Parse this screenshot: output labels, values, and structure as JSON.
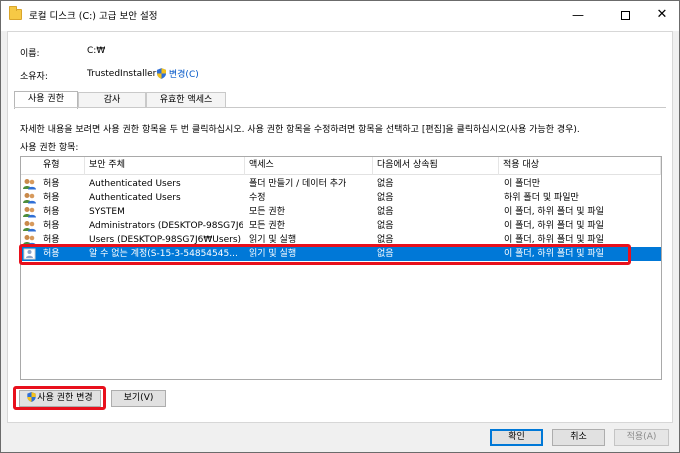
{
  "window": {
    "title": "로컬 디스크 (C:) 고급 보안 설정"
  },
  "info": {
    "name_label": "이름:",
    "name_value": "C:₩",
    "owner_label": "소유자:",
    "owner_value": "TrustedInstaller",
    "change_link": "변경(C)"
  },
  "tabs": [
    {
      "label": "사용 권한",
      "active": true
    },
    {
      "label": "감사",
      "active": false
    },
    {
      "label": "유효한 액세스",
      "active": false
    }
  ],
  "description": "자세한 내용을 보려면 사용 권한 항목을 두 번 클릭하십시오. 사용 권한 항목을 수정하려면 항목을 선택하고 [편집]을 클릭하십시오(사용 가능한 경우).",
  "entries_label": "사용 권한 항목:",
  "columns": [
    "유형",
    "보안 주체",
    "액세스",
    "다음에서 상속됨",
    "적용 대상"
  ],
  "rows": [
    {
      "type": "허용",
      "principal": "Authenticated Users",
      "access": "폴더 만들기 / 데이터 추가",
      "inherited": "없음",
      "applies": "이 폴더만",
      "icon": "users-icon"
    },
    {
      "type": "허용",
      "principal": "Authenticated Users",
      "access": "수정",
      "inherited": "없음",
      "applies": "하위 폴더 및 파일만",
      "icon": "users-icon"
    },
    {
      "type": "허용",
      "principal": "SYSTEM",
      "access": "모든 권한",
      "inherited": "없음",
      "applies": "이 폴더, 하위 폴더 및 파일",
      "icon": "users-icon"
    },
    {
      "type": "허용",
      "principal": "Administrators (DESKTOP-98SG7J6...",
      "access": "모든 권한",
      "inherited": "없음",
      "applies": "이 폴더, 하위 폴더 및 파일",
      "icon": "users-icon"
    },
    {
      "type": "허용",
      "principal": "Users (DESKTOP-98SG7J6₩Users)",
      "access": "읽기 및 실행",
      "inherited": "없음",
      "applies": "이 폴더, 하위 폴더 및 파일",
      "icon": "users-icon"
    },
    {
      "type": "허용",
      "principal": "알 수 없는 계정(S-15-3-54854545...",
      "access": "읽기 및 실행",
      "inherited": "없음",
      "applies": "이 폴더, 하위 폴더 및 파일",
      "icon": "unknown-user-icon",
      "selected": true
    }
  ],
  "buttons": {
    "change_permissions": "사용 권한 변경",
    "view": "보기(V)",
    "ok": "확인",
    "cancel": "취소",
    "apply": "적용(A)"
  },
  "colors": {
    "selection": "#0078d7",
    "highlight": "#e8101c",
    "link": "#0056c7"
  }
}
